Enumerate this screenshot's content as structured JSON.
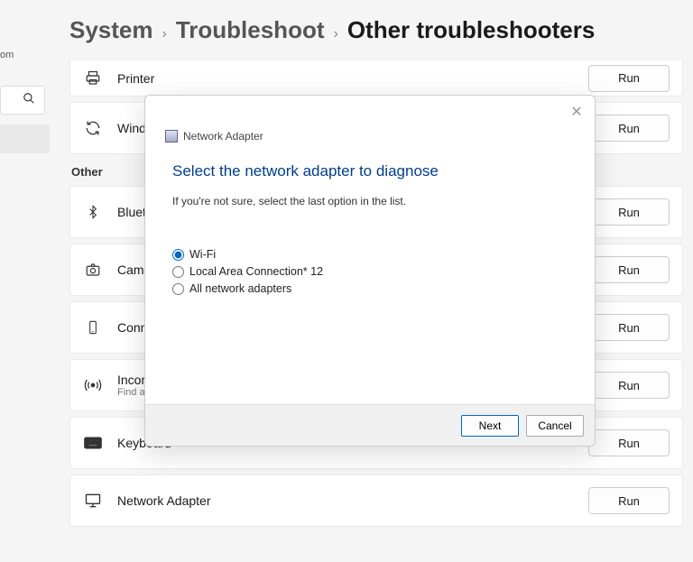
{
  "sidebar": {
    "truncated_label": "om"
  },
  "breadcrumb": {
    "system": "System",
    "troubleshoot": "Troubleshoot",
    "current": "Other troubleshooters"
  },
  "section_other": "Other",
  "run_label": "Run",
  "items": [
    {
      "icon": "printer-icon",
      "label": "Printer"
    },
    {
      "icon": "sync-icon",
      "label": "Windows Update"
    },
    {
      "icon": "bluetooth-icon",
      "label": "Bluetooth"
    },
    {
      "icon": "camera-icon",
      "label": "Camera"
    },
    {
      "icon": "phone-icon",
      "label": "Connection"
    },
    {
      "icon": "broadcast-icon",
      "label": "Incoming Connections",
      "sub": "Find and fix problems"
    },
    {
      "icon": "keyboard-icon",
      "label": "Keyboard"
    },
    {
      "icon": "monitor-icon",
      "label": "Network Adapter"
    }
  ],
  "dialog": {
    "app": "Network Adapter",
    "title": "Select the network adapter to diagnose",
    "desc": "If you're not sure, select the last option in the list.",
    "options": [
      "Wi-Fi",
      "Local Area Connection* 12",
      "All network adapters"
    ],
    "next": "Next",
    "cancel": "Cancel"
  }
}
